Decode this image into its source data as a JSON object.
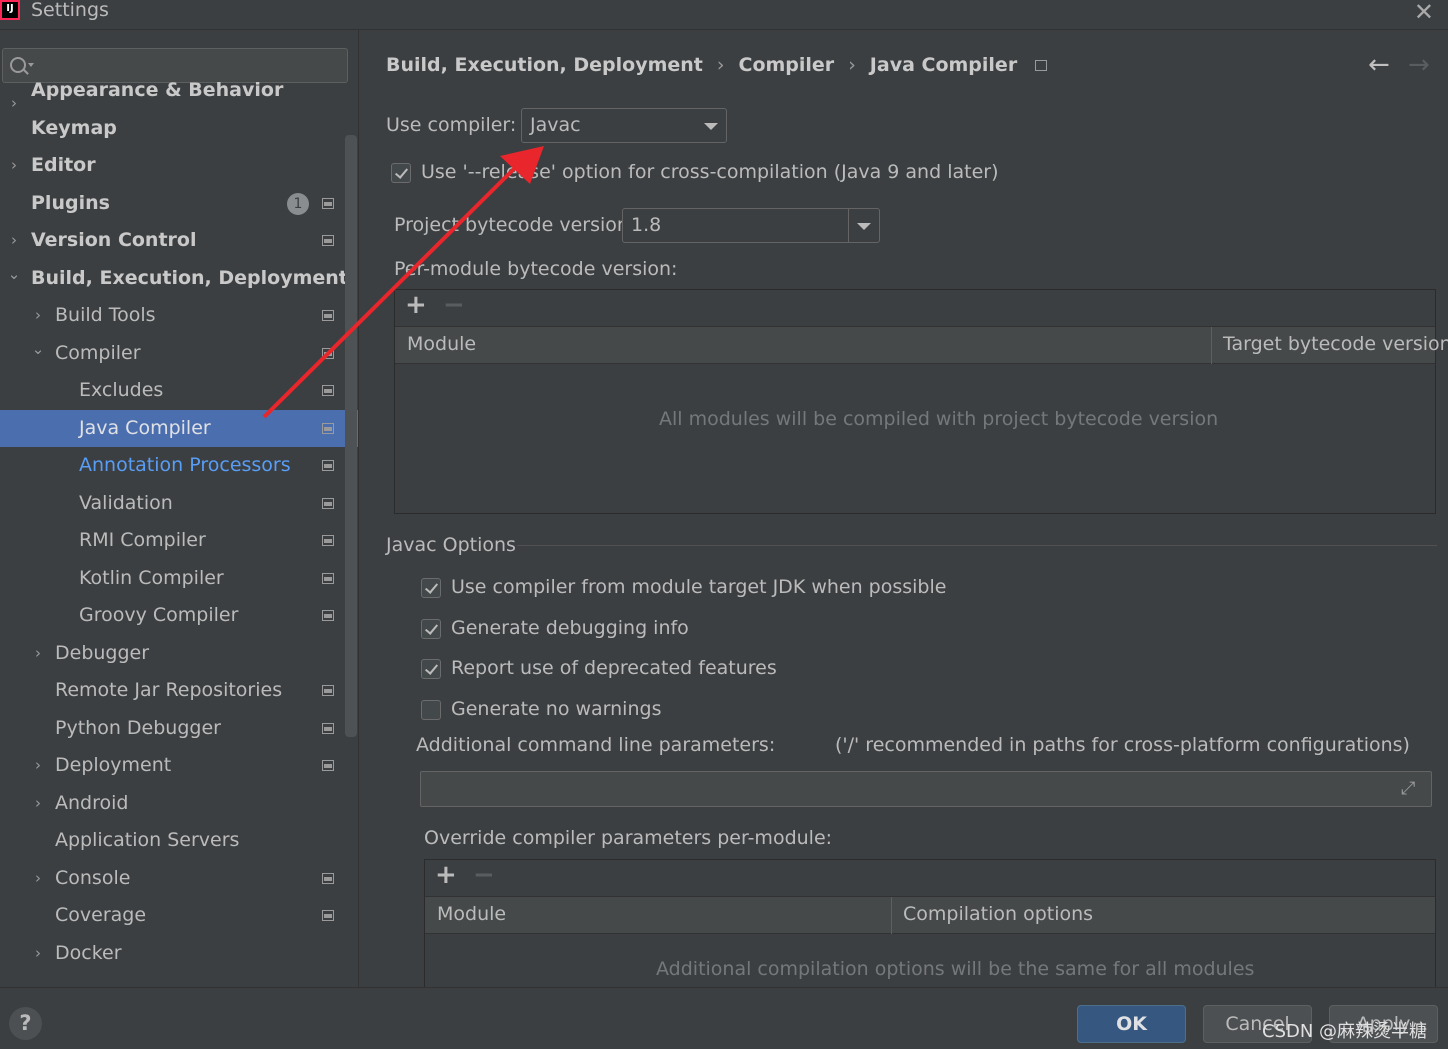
{
  "window": {
    "title": "Settings",
    "app_icon_text": "IJ"
  },
  "search": {
    "placeholder": ""
  },
  "sidebar": {
    "items": [
      {
        "label": "Appearance & Behavior",
        "chevron": "›",
        "bold": true
      },
      {
        "label": "Keymap",
        "bold": true
      },
      {
        "label": "Editor",
        "chevron": "›",
        "bold": true
      },
      {
        "label": "Plugins",
        "bold": true,
        "badge": "1"
      },
      {
        "label": "Version Control",
        "chevron": "›",
        "bold": true
      },
      {
        "label": "Build, Execution, Deployment",
        "chevron": "⌄",
        "bold": true
      },
      {
        "label": "Build Tools",
        "chevron": "›"
      },
      {
        "label": "Compiler",
        "chevron": "⌄"
      },
      {
        "label": "Excludes"
      },
      {
        "label": "Java Compiler",
        "selected": true
      },
      {
        "label": "Annotation Processors",
        "link": true
      },
      {
        "label": "Validation"
      },
      {
        "label": "RMI Compiler"
      },
      {
        "label": "Kotlin Compiler"
      },
      {
        "label": "Groovy Compiler"
      },
      {
        "label": "Debugger",
        "chevron": "›"
      },
      {
        "label": "Remote Jar Repositories"
      },
      {
        "label": "Python Debugger"
      },
      {
        "label": "Deployment",
        "chevron": "›"
      },
      {
        "label": "Android",
        "chevron": "›"
      },
      {
        "label": "Application Servers"
      },
      {
        "label": "Console",
        "chevron": "›"
      },
      {
        "label": "Coverage"
      },
      {
        "label": "Docker",
        "chevron": "›"
      }
    ]
  },
  "breadcrumb": {
    "part1": "Build, Execution, Deployment",
    "part2": "Compiler",
    "part3": "Java Compiler",
    "sep": "›"
  },
  "nav": {
    "back": "←",
    "forward": "→"
  },
  "compiler": {
    "use_compiler_label": "Use compiler:",
    "use_compiler_value": "Javac",
    "release_option_label": "Use '--release' option for cross-compilation (Java 9 and later)",
    "release_option_checked": true,
    "bytecode_label": "Project bytecode version:",
    "bytecode_value": "1.8",
    "per_module_label": "Per-module bytecode version:"
  },
  "module_table": {
    "columns": [
      "Module",
      "Target bytecode version"
    ],
    "empty_text": "All modules will be compiled with project bytecode version",
    "add": "+",
    "remove": "−"
  },
  "javac_options": {
    "section_title": "Javac Options",
    "checkboxes": [
      {
        "label": "Use compiler from module target JDK when possible",
        "checked": true
      },
      {
        "label": "Generate debugging info",
        "checked": true
      },
      {
        "label": "Report use of deprecated features",
        "checked": true
      },
      {
        "label": "Generate no warnings",
        "checked": false
      }
    ],
    "additional_params_label": "Additional command line parameters:",
    "additional_params_hint": "('/' recommended in paths for cross-platform configurations)",
    "additional_params_value": "",
    "expand_icon": "⤢",
    "override_label": "Override compiler parameters per-module:"
  },
  "override_table": {
    "columns": [
      "Module",
      "Compilation options"
    ],
    "empty_text": "Additional compilation options will be the same for all modules",
    "add": "+",
    "remove": "−"
  },
  "footer": {
    "help": "?",
    "ok": "OK",
    "cancel": "Cancel",
    "apply": "Apply",
    "watermark": "CSDN @麻辣烫半糖"
  },
  "colors": {
    "background": "#3c3f41",
    "selection": "#4b6eaf",
    "link": "#589df6",
    "ok_button": "#365880",
    "annotation_arrow": "#e8262b"
  }
}
